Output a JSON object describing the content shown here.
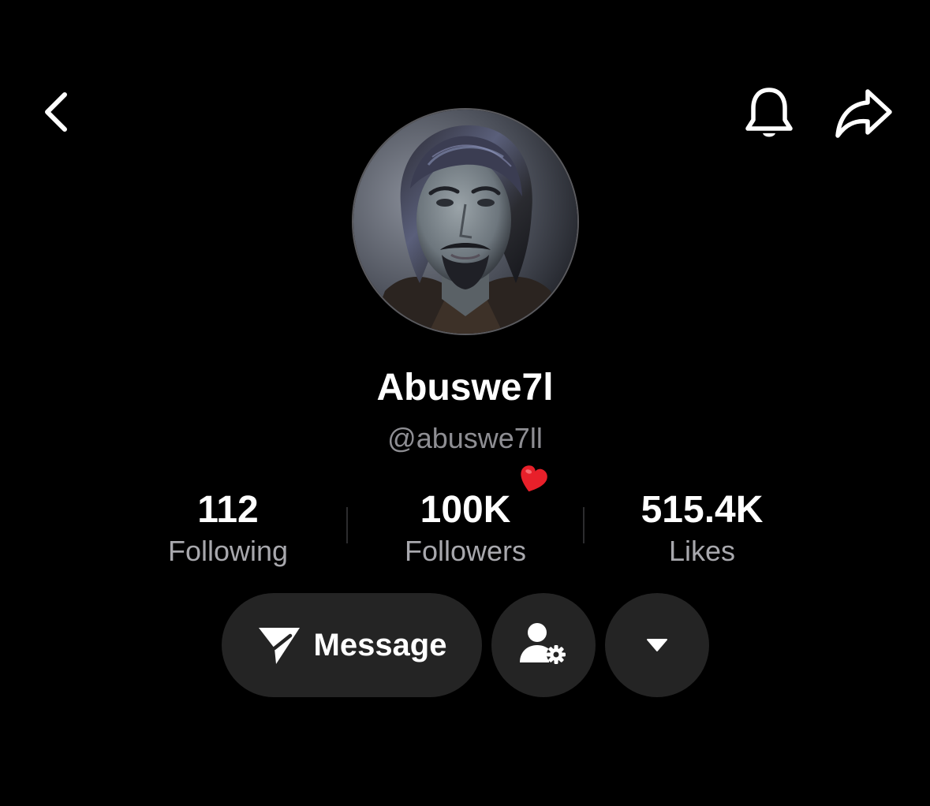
{
  "profile": {
    "display_name": "Abuswe7l",
    "handle": "@abuswe7ll"
  },
  "stats": {
    "following": {
      "value": "112",
      "label": "Following"
    },
    "followers": {
      "value": "100K",
      "label": "Followers"
    },
    "likes": {
      "value": "515.4K",
      "label": "Likes"
    }
  },
  "actions": {
    "message_label": "Message"
  },
  "icons": {
    "back": "chevron-left-icon",
    "notifications": "bell-icon",
    "share": "share-arrow-icon",
    "message": "paper-plane-icon",
    "profile_settings": "user-gear-icon",
    "more": "caret-down-icon",
    "followers_badge": "red-heart-icon"
  },
  "colors": {
    "background": "#000000",
    "text_primary": "#ffffff",
    "text_secondary": "#a8a8ad",
    "button_fill": "#242424",
    "heart": "#e8202a"
  }
}
